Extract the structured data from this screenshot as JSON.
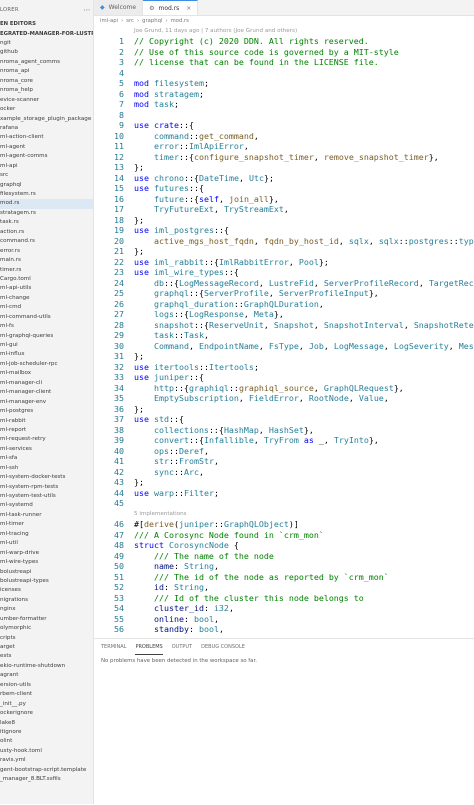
{
  "sidebar": {
    "header": "LORER",
    "open_editors": "EN EDITORS",
    "project": "EGRATED-MANAGER-FOR-LUSTRE",
    "items": [
      {
        "label": "ngit"
      },
      {
        "label": "github"
      },
      {
        "label": "nroma_agent_comms"
      },
      {
        "label": "nroma_api"
      },
      {
        "label": "nroma_core"
      },
      {
        "label": "nroma_help"
      },
      {
        "label": "evice-scanner"
      },
      {
        "label": "ocker"
      },
      {
        "label": "xample_storage_plugin_package"
      },
      {
        "label": "rafana"
      },
      {
        "label": "ml-action-client"
      },
      {
        "label": "ml-agent"
      },
      {
        "label": "ml-agent-comms"
      },
      {
        "label": "ml-api"
      },
      {
        "label": "src"
      },
      {
        "label": "graphql"
      },
      {
        "label": "filesystem.rs"
      },
      {
        "label": "mod.rs",
        "selected": true
      },
      {
        "label": "stratagem.rs"
      },
      {
        "label": "task.rs"
      },
      {
        "label": "action.rs"
      },
      {
        "label": "command.rs"
      },
      {
        "label": "error.rs"
      },
      {
        "label": "main.rs"
      },
      {
        "label": "timer.rs"
      },
      {
        "label": "Cargo.toml"
      },
      {
        "label": "ml-api-utils"
      },
      {
        "label": "ml-change"
      },
      {
        "label": "ml-cmd"
      },
      {
        "label": "ml-command-utils"
      },
      {
        "label": "ml-fs"
      },
      {
        "label": "ml-graphql-queries"
      },
      {
        "label": "ml-gui"
      },
      {
        "label": "ml-influx"
      },
      {
        "label": "ml-job-scheduler-rpc"
      },
      {
        "label": "ml-mailbox"
      },
      {
        "label": "ml-manager-cli"
      },
      {
        "label": "ml-manager-client"
      },
      {
        "label": "ml-manager-env"
      },
      {
        "label": "ml-postgres"
      },
      {
        "label": "ml-rabbit"
      },
      {
        "label": "ml-report"
      },
      {
        "label": "ml-request-retry"
      },
      {
        "label": "ml-services"
      },
      {
        "label": "ml-sfa"
      },
      {
        "label": "ml-ssh"
      },
      {
        "label": "ml-system-docker-tests"
      },
      {
        "label": "ml-system-rpm-tests"
      },
      {
        "label": "ml-system-test-utils"
      },
      {
        "label": "ml-systemd"
      },
      {
        "label": "ml-task-runner"
      },
      {
        "label": "ml-timer"
      },
      {
        "label": "ml-tracing"
      },
      {
        "label": "ml-util"
      },
      {
        "label": "ml-warp-drive"
      },
      {
        "label": "ml-wire-types"
      },
      {
        "label": "bolustreapi"
      },
      {
        "label": "bolustreapi-types"
      },
      {
        "label": "icenses"
      },
      {
        "label": "nigrations"
      },
      {
        "label": "nginx"
      },
      {
        "label": "umber-formatter"
      },
      {
        "label": "olymorphic"
      },
      {
        "label": "cripts"
      },
      {
        "label": "arget"
      },
      {
        "label": "ests"
      },
      {
        "label": "ekio-runtime-shutdown"
      },
      {
        "label": "agrant"
      },
      {
        "label": "ersion-utils"
      },
      {
        "label": "rbem-client"
      },
      {
        "label": "_init__.py"
      },
      {
        "label": "ockerignore"
      },
      {
        "label": "lake8"
      },
      {
        "label": "itignore"
      },
      {
        "label": "olint"
      },
      {
        "label": "usty-hook.toml"
      },
      {
        "label": "ravis.yml"
      },
      {
        "label": "gent-bootstrap-script.template"
      },
      {
        "label": "_manager_8.BLT.ssfils"
      }
    ]
  },
  "tabs": [
    {
      "label": "Welcome",
      "icon": "vscode-icon",
      "active": false
    },
    {
      "label": "mod.rs",
      "icon": "rust-icon",
      "active": true
    }
  ],
  "breadcrumb": [
    "iml-api",
    "src",
    "graphql",
    "mod.rs"
  ],
  "blame_header": "Joe Grund, 11 days ago | 7 authors (Joe Grund and others)",
  "lens_text": "5 implementations",
  "code_lines": [
    {
      "n": "1",
      "html": "<span class='c'>// Copyright (c) 2020 DDN. All rights reserved.</span>"
    },
    {
      "n": "2",
      "html": "<span class='c'>// Use of this source code is governed by a MIT-style</span>"
    },
    {
      "n": "3",
      "html": "<span class='c'>// license that can be found in the LICENSE file.</span>"
    },
    {
      "n": "4",
      "html": ""
    },
    {
      "n": "5",
      "html": "<span class='k'>mod</span> <span class='t'>filesystem</span>;"
    },
    {
      "n": "6",
      "html": "<span class='k'>mod</span> <span class='t'>stratagem</span>;"
    },
    {
      "n": "7",
      "html": "<span class='k'>mod</span> <span class='t'>task</span>;"
    },
    {
      "n": "8",
      "html": ""
    },
    {
      "n": "9",
      "html": "<span class='k'>use</span> <span class='k'>crate</span>::{"
    },
    {
      "n": "10",
      "html": "    <span class='t'>command</span>::<span class='f'>get_command</span>,"
    },
    {
      "n": "11",
      "html": "    <span class='t'>error</span>::<span class='t'>ImlApiError</span>,"
    },
    {
      "n": "12",
      "html": "    <span class='t'>timer</span>::{<span class='f'>configure_snapshot_timer</span>, <span class='f'>remove_snapshot_timer</span>},"
    },
    {
      "n": "13",
      "html": "};"
    },
    {
      "n": "14",
      "html": "<span class='k'>use</span> <span class='t'>chrono</span>::{<span class='t'>DateTime</span>, <span class='t'>Utc</span>};"
    },
    {
      "n": "15",
      "html": "<span class='k'>use</span> <span class='t'>futures</span>::{"
    },
    {
      "n": "16",
      "html": "    <span class='t'>future</span>::{<span class='k'>self</span>, <span class='f'>join_all</span>},"
    },
    {
      "n": "17",
      "html": "    <span class='t'>TryFutureExt</span>, <span class='t'>TryStreamExt</span>,"
    },
    {
      "n": "18",
      "html": "};"
    },
    {
      "n": "19",
      "html": "<span class='k'>use</span> <span class='t'>iml_postgres</span>::{"
    },
    {
      "n": "20",
      "html": "    <span class='f'>active_mgs_host_fqdn</span>, <span class='f'>fqdn_by_host_id</span>, <span class='t'>sqlx</span>, <span class='t'>sqlx</span>::<span class='t'>postgres</span>::<span class='t'>types</span>::"
    },
    {
      "n": "21",
      "html": "};"
    },
    {
      "n": "22",
      "html": "<span class='k'>use</span> <span class='t'>iml_rabbit</span>::{<span class='t'>ImlRabbitError</span>, <span class='t'>Pool</span>};"
    },
    {
      "n": "23",
      "html": "<span class='k'>use</span> <span class='t'>iml_wire_types</span>::{"
    },
    {
      "n": "24",
      "html": "    <span class='t'>db</span>::{<span class='t'>LogMessageRecord</span>, <span class='t'>LustreFid</span>, <span class='t'>ServerProfileRecord</span>, <span class='t'>TargetRecord</span>"
    },
    {
      "n": "25",
      "html": "    <span class='t'>graphql</span>::{<span class='t'>ServerProfile</span>, <span class='t'>ServerProfileInput</span>},"
    },
    {
      "n": "26",
      "html": "    <span class='t'>graphql_duration</span>::<span class='t'>GraphQLDuration</span>,"
    },
    {
      "n": "27",
      "html": "    <span class='t'>logs</span>::{<span class='t'>LogResponse</span>, <span class='t'>Meta</span>},"
    },
    {
      "n": "28",
      "html": "    <span class='t'>snapshot</span>::{<span class='t'>ReserveUnit</span>, <span class='t'>Snapshot</span>, <span class='t'>SnapshotInterval</span>, <span class='t'>SnapshotRetenti</span>"
    },
    {
      "n": "29",
      "html": "    <span class='t'>task</span>::<span class='t'>Task</span>,"
    },
    {
      "n": "30",
      "html": "    <span class='t'>Command</span>, <span class='t'>EndpointName</span>, <span class='t'>FsType</span>, <span class='t'>Job</span>, <span class='t'>LogMessage</span>, <span class='t'>LogSeverity</span>, <span class='t'>Messag</span>"
    },
    {
      "n": "31",
      "html": "};"
    },
    {
      "n": "32",
      "html": "<span class='k'>use</span> <span class='t'>itertools</span>::<span class='t'>Itertools</span>;"
    },
    {
      "n": "33",
      "html": "<span class='k'>use</span> <span class='t'>juniper</span>::{"
    },
    {
      "n": "34",
      "html": "    <span class='t'>http</span>::{<span class='t'>graphiql</span>::<span class='f'>graphiql_source</span>, <span class='t'>GraphQLRequest</span>},"
    },
    {
      "n": "35",
      "html": "    <span class='t'>EmptySubscription</span>, <span class='t'>FieldError</span>, <span class='t'>RootNode</span>, <span class='t'>Value</span>,"
    },
    {
      "n": "36",
      "html": "};"
    },
    {
      "n": "37",
      "html": "<span class='k'>use</span> <span class='t'>std</span>::{"
    },
    {
      "n": "38",
      "html": "    <span class='t'>collections</span>::{<span class='t'>HashMap</span>, <span class='t'>HashSet</span>},"
    },
    {
      "n": "39",
      "html": "    <span class='t'>convert</span>::{<span class='t'>Infallible</span>, <span class='t'>TryFrom</span> <span class='k'>as</span> _, <span class='t'>TryInto</span>},"
    },
    {
      "n": "40",
      "html": "    <span class='t'>ops</span>::<span class='t'>Deref</span>,"
    },
    {
      "n": "41",
      "html": "    <span class='t'>str</span>::<span class='t'>FromStr</span>,"
    },
    {
      "n": "42",
      "html": "    <span class='t'>sync</span>::<span class='t'>Arc</span>,"
    },
    {
      "n": "43",
      "html": "};"
    },
    {
      "n": "44",
      "html": "<span class='k'>use</span> <span class='t'>warp</span>::<span class='t'>Filter</span>;"
    },
    {
      "n": "45",
      "html": ""
    },
    {
      "n": "LENS",
      "html": ""
    },
    {
      "n": "46",
      "html": "#[<span class='f'>derive</span>(<span class='t'>juniper</span>::<span class='t'>GraphQLObject</span>)]"
    },
    {
      "n": "47",
      "html": "<span class='c'>/// A Corosync Node found in `crm_mon`</span>"
    },
    {
      "n": "48",
      "html": "<span class='k'>struct</span> <span class='t'>CorosyncNode</span> {"
    },
    {
      "n": "49",
      "html": "    <span class='c'>/// The name of the node</span>"
    },
    {
      "n": "50",
      "html": "    <span class='v'>name</span>: <span class='t'>String</span>,"
    },
    {
      "n": "51",
      "html": "    <span class='c'>/// The id of the node as reported by `crm_mon`</span>"
    },
    {
      "n": "52",
      "html": "    <span class='v'>id</span>: <span class='t'>String</span>,"
    },
    {
      "n": "53",
      "html": "    <span class='c'>/// Id of the cluster this node belongs to</span>"
    },
    {
      "n": "54",
      "html": "    <span class='v'>cluster_id</span>: <span class='t'>i32</span>,"
    },
    {
      "n": "55",
      "html": "    <span class='v'>online</span>: <span class='t'>bool</span>,"
    },
    {
      "n": "56",
      "html": "    <span class='v'>standby</span>: <span class='t'>bool</span>,"
    }
  ],
  "panel": {
    "tabs": [
      {
        "label": "TERMINAL",
        "active": false
      },
      {
        "label": "PROBLEMS",
        "active": true
      },
      {
        "label": "OUTPUT",
        "active": false
      },
      {
        "label": "DEBUG CONSOLE",
        "active": false
      }
    ],
    "message": "No problems have been detected in the workspace so far."
  }
}
